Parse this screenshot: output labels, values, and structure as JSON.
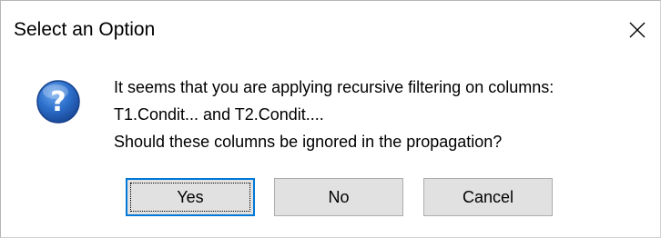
{
  "window": {
    "title": "Select an Option",
    "close_icon": "close-icon"
  },
  "message": {
    "icon": "question-icon",
    "icon_glyph": "?",
    "icon_color": "#1f5fb7",
    "lines": [
      "It seems that you are applying recursive filtering on columns:",
      "T1.Condit... and T2.Condit....",
      "Should these columns be ignored in the propagation?"
    ]
  },
  "buttons": {
    "yes_label": "Yes",
    "no_label": "No",
    "cancel_label": "Cancel",
    "default": "Yes",
    "accent_color": "#0078d7"
  }
}
